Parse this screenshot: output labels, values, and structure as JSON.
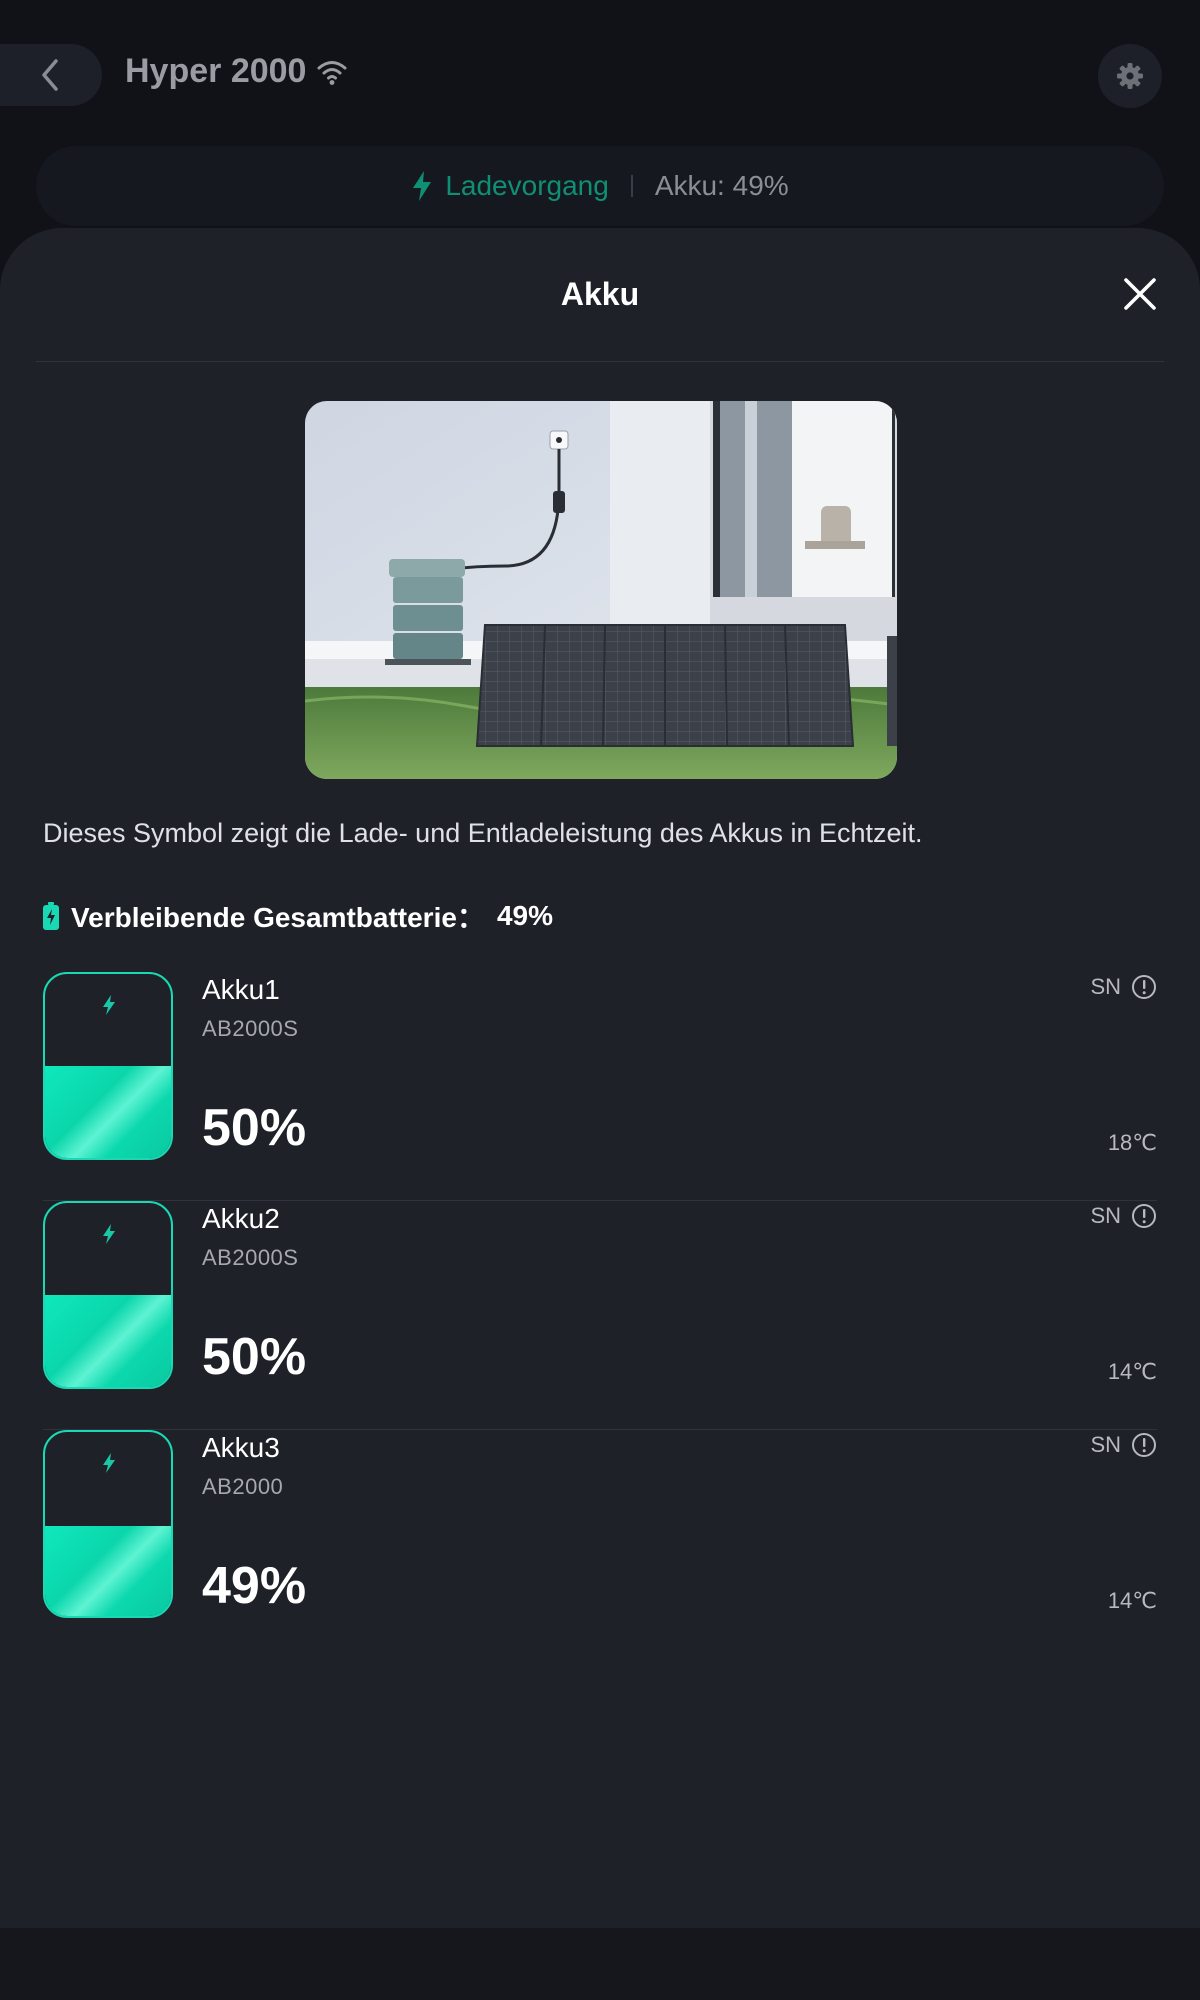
{
  "header": {
    "back_icon": "chevron-left-icon",
    "device_name": "Hyper 2000",
    "wifi_icon": "wifi-icon",
    "settings_icon": "gear-icon",
    "status": {
      "charging_icon": "bolt-icon",
      "charging_label": "Ladevorgang",
      "battery_text": "Akku: 49%"
    }
  },
  "sheet": {
    "title": "Akku",
    "close_icon": "close-icon",
    "description": "Dieses Symbol zeigt die Lade- und Entladeleistung des Akkus in Echtzeit.",
    "total": {
      "icon": "battery-icon",
      "label": "Verbleibende Gesamtbatterie：",
      "value": "49%"
    },
    "batteries": [
      {
        "name": "Akku1",
        "model": "AB2000S",
        "percent_text": "50%",
        "level": 0.5,
        "sn_label": "SN",
        "temperature": "18℃"
      },
      {
        "name": "Akku2",
        "model": "AB2000S",
        "percent_text": "50%",
        "level": 0.5,
        "sn_label": "SN",
        "temperature": "14℃"
      },
      {
        "name": "Akku3",
        "model": "AB2000",
        "percent_text": "49%",
        "level": 0.49,
        "sn_label": "SN",
        "temperature": "14℃"
      }
    ]
  },
  "colors": {
    "accent": "#19d9b4",
    "charging": "#0f8f74",
    "sheet_bg": "#1f2129",
    "app_bg": "#101218"
  }
}
